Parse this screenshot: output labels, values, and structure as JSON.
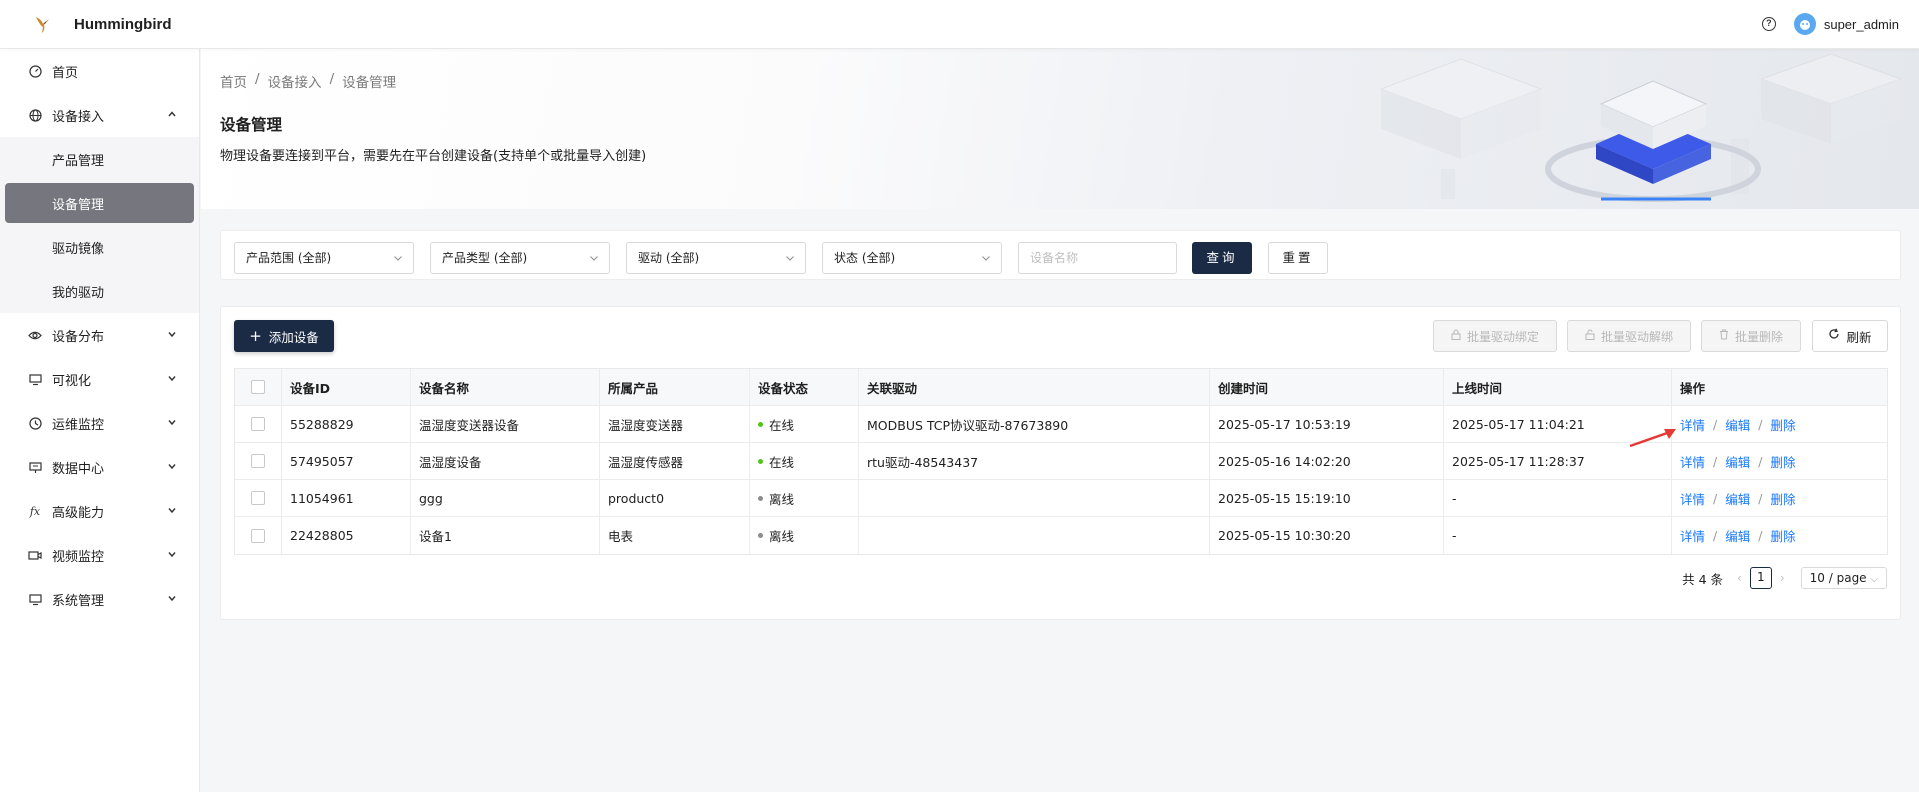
{
  "app": {
    "title": "Hummingbird"
  },
  "header": {
    "user_name": "super_admin",
    "help_icon": "help-circle-icon"
  },
  "sidebar": {
    "items": [
      {
        "label": "首页",
        "icon": "dashboard-icon",
        "expandable": false
      },
      {
        "label": "设备接入",
        "icon": "globe-icon",
        "expandable": true,
        "expanded": true,
        "children": [
          {
            "label": "产品管理",
            "active": false
          },
          {
            "label": "设备管理",
            "active": true
          },
          {
            "label": "驱动镜像",
            "active": false
          },
          {
            "label": "我的驱动",
            "active": false
          }
        ]
      },
      {
        "label": "设备分布",
        "icon": "eye-icon",
        "expandable": true
      },
      {
        "label": "可视化",
        "icon": "monitor-icon",
        "expandable": true
      },
      {
        "label": "运维监控",
        "icon": "clock-icon",
        "expandable": true
      },
      {
        "label": "数据中心",
        "icon": "data-screen-icon",
        "expandable": true
      },
      {
        "label": "高级能力",
        "icon": "function-icon",
        "expandable": true
      },
      {
        "label": "视频监控",
        "icon": "video-icon",
        "expandable": true
      },
      {
        "label": "系统管理",
        "icon": "desktop-icon",
        "expandable": true
      }
    ]
  },
  "breadcrumb": [
    "首页",
    "设备接入",
    "设备管理"
  ],
  "page": {
    "title": "设备管理",
    "description": "物理设备要连接到平台，需要先在平台创建设备(支持单个或批量导入创建)"
  },
  "filters": {
    "selects": [
      "产品范围 (全部)",
      "产品类型 (全部)",
      "驱动 (全部)",
      "状态 (全部)"
    ],
    "name_placeholder": "设备名称",
    "query_label": "查询",
    "reset_label": "重置"
  },
  "toolbar": {
    "add_label": "添加设备",
    "batch_bind_label": "批量驱动绑定",
    "batch_unbind_label": "批量驱动解绑",
    "batch_delete_label": "批量删除",
    "refresh_label": "刷新"
  },
  "table": {
    "columns": [
      "设备ID",
      "设备名称",
      "所属产品",
      "设备状态",
      "关联驱动",
      "创建时间",
      "上线时间",
      "操作"
    ],
    "rows": [
      {
        "id": "55288829",
        "name": "温湿度变送器设备",
        "product": "温湿度变送器",
        "status": "在线",
        "status_color": "#52c41a",
        "driver": "MODBUS TCP协议驱动-87673890",
        "created": "2025-05-17 10:53:19",
        "online": "2025-05-17 11:04:21"
      },
      {
        "id": "57495057",
        "name": "温湿度设备",
        "product": "温湿度传感器",
        "status": "在线",
        "status_color": "#52c41a",
        "driver": "rtu驱动-48543437",
        "created": "2025-05-16 14:02:20",
        "online": "2025-05-17 11:28:37"
      },
      {
        "id": "11054961",
        "name": "ggg",
        "product": "product0",
        "status": "离线",
        "status_color": "#8c8c8c",
        "driver": "",
        "created": "2025-05-15 15:19:10",
        "online": "-"
      },
      {
        "id": "22428805",
        "name": "设备1",
        "product": "电表",
        "status": "离线",
        "status_color": "#8c8c8c",
        "driver": "",
        "created": "2025-05-15 10:30:20",
        "online": "-"
      }
    ],
    "actions": {
      "detail": "详情",
      "edit": "编辑",
      "delete": "删除",
      "sep": "/"
    }
  },
  "pagination": {
    "total_text": "共 4 条",
    "current_page": "1",
    "page_size": "10 / page"
  },
  "colors": {
    "primary": "#1b2a45",
    "link": "#1677ff",
    "online": "#52c41a",
    "offline": "#8c8c8c",
    "annotation_arrow": "#e53935"
  }
}
